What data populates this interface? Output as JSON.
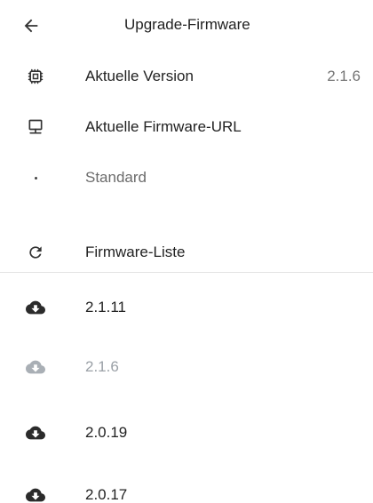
{
  "app_bar": {
    "back_icon": "arrow-back-icon",
    "title": "Upgrade-Firmware"
  },
  "info": {
    "current_version": {
      "icon": "chip-icon",
      "label": "Aktuelle Version",
      "value": "2.1.6"
    },
    "firmware_url": {
      "icon": "monitor-icon",
      "label": "Aktuelle Firmware-URL"
    },
    "url_option": {
      "icon": "dot-icon",
      "label": "Standard"
    }
  },
  "firmware_list": {
    "icon": "refresh-icon",
    "label": "Firmware-Liste",
    "items": [
      {
        "version": "2.1.11",
        "icon": "cloud-download-icon",
        "active": true
      },
      {
        "version": "2.1.6",
        "icon": "cloud-download-icon",
        "active": false
      },
      {
        "version": "2.0.19",
        "icon": "cloud-download-icon",
        "active": true
      },
      {
        "version": "2.0.17",
        "icon": "cloud-download-icon",
        "active": true
      }
    ]
  },
  "colors": {
    "text": "#222222",
    "muted": "#757575",
    "disabled": "#9aa0a6",
    "icon": "#333333",
    "divider": "#e3e3e3"
  }
}
